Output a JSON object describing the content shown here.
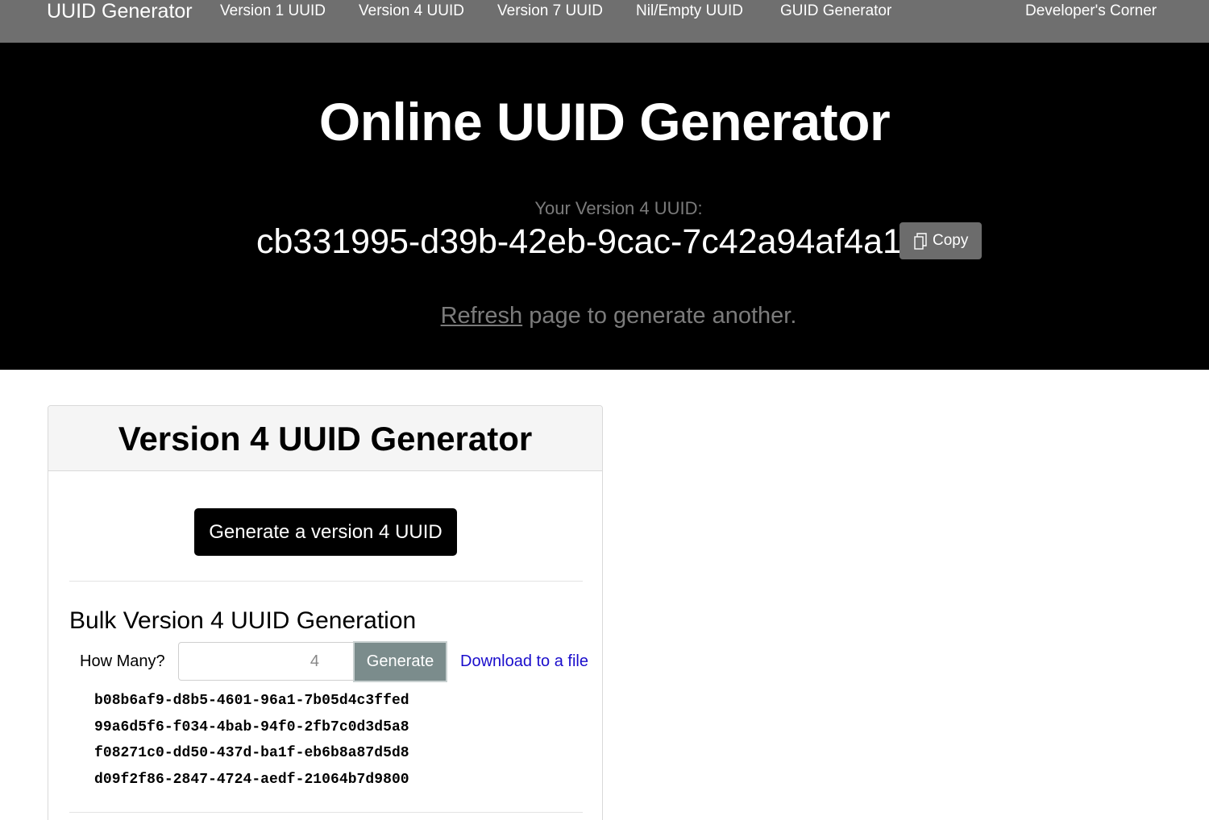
{
  "nav": {
    "brand": "UUID Generator",
    "links": [
      "Version 1 UUID",
      "Version 4 UUID",
      "Version 7 UUID",
      "Nil/Empty UUID",
      "GUID Generator",
      "Developer's Corner"
    ]
  },
  "hero": {
    "title": "Online UUID Generator",
    "uuid_label": "Your Version 4 UUID:",
    "uuid_value": "cb331995-d39b-42eb-9cac-7c42a94af4a1",
    "copy_label": "Copy",
    "refresh_link": "Refresh",
    "refresh_rest": " page to generate another."
  },
  "card": {
    "title": "Version 4 UUID Generator",
    "generate_label": "Generate a version 4 UUID",
    "bulk_title": "Bulk Version 4 UUID Generation",
    "how_many_label": "How Many?",
    "how_many_value": "4",
    "bulk_generate_label": "Generate",
    "download_label": "Download to a file",
    "uuids": [
      "b08b6af9-d8b5-4601-96a1-7b05d4c3ffed",
      "99a6d5f6-f034-4bab-94f0-2fb7c0d3d5a8",
      "f08271c0-dd50-437d-ba1f-eb6b8a87d5d8",
      "d09f2f86-2847-4724-aedf-21064b7d9800"
    ]
  },
  "colors": {
    "nav_bg": "#6f6f6f",
    "hero_bg": "#000000",
    "muted_text": "#7b7b7b",
    "link": "#1a0dcc",
    "bulk_button": "#7b8c8c"
  },
  "icons": {
    "copy": "copy-icon"
  }
}
